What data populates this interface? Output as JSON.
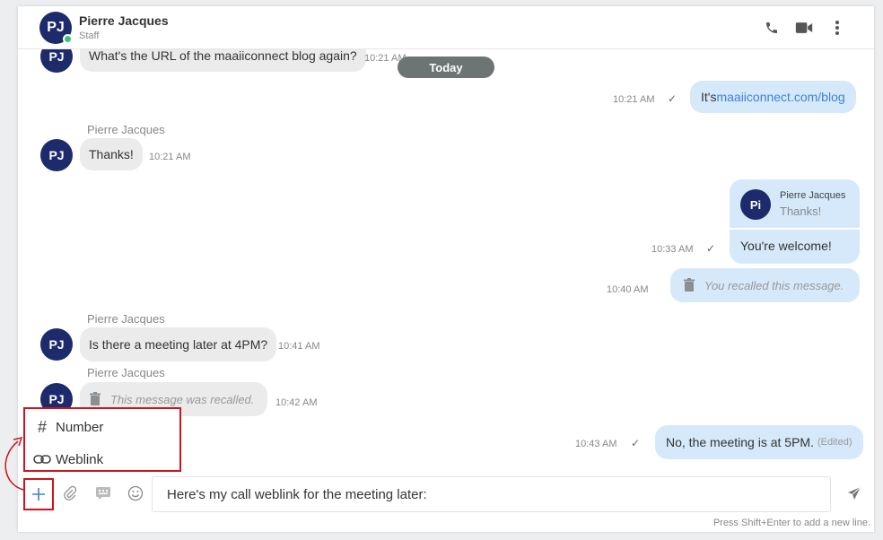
{
  "header": {
    "avatar_initials": "PJ",
    "name": "Pierre Jacques",
    "role": "Staff",
    "icons": [
      "phone-icon",
      "video-icon",
      "more-vertical-icon"
    ]
  },
  "date_divider": "Today",
  "messages": [
    {
      "dir": "in",
      "avatar": "PJ",
      "text": "What's the URL of the maaiiconnect blog again?",
      "time": "10:21 AM"
    },
    {
      "dir": "out",
      "prefix": "It's ",
      "link": "maaiiconnect.com/blog",
      "time": "10:21 AM",
      "status": "✓"
    },
    {
      "dir": "in",
      "sender": "Pierre Jacques",
      "avatar": "PJ",
      "text": "Thanks!",
      "time": "10:21 AM"
    },
    {
      "dir": "out",
      "quote_avatar": "Pi",
      "quote_sender": "Pierre Jacques",
      "quote_text": "Thanks!",
      "text": "You're welcome!",
      "time": "10:33 AM",
      "status": "✓"
    },
    {
      "dir": "out",
      "recalled": true,
      "text": "You recalled this message.",
      "time": "10:40 AM"
    },
    {
      "dir": "in",
      "sender": "Pierre Jacques",
      "avatar": "PJ",
      "text": "Is there a meeting later at 4PM?",
      "time": "10:41 AM"
    },
    {
      "dir": "in",
      "sender": "Pierre Jacques",
      "avatar": "PJ",
      "recalled": true,
      "text": "This message was recalled.",
      "time": "10:42 AM"
    },
    {
      "dir": "out",
      "text": "No, the meeting is at 5PM.",
      "edited": "(Edited)",
      "time": "10:43 AM",
      "status": "✓"
    }
  ],
  "popup_menu": {
    "items": [
      {
        "icon": "hash-icon",
        "glyph": "#",
        "label": "Number"
      },
      {
        "icon": "link-icon",
        "label": "Weblink"
      }
    ]
  },
  "composer": {
    "value": "Here's my call weblink for the meeting later:",
    "hint": "Press Shift+Enter to add a new line.",
    "icons": [
      "plus-icon",
      "attachment-icon",
      "quick-reply-icon",
      "emoji-icon",
      "send-icon"
    ]
  },
  "colors": {
    "accent": "#1d2a6b",
    "outgoing_bubble": "#d5e9fb",
    "incoming_bubble": "#ebebeb",
    "highlight_red": "#d0121b",
    "link": "#3f82d1",
    "online": "#3ec46d"
  }
}
